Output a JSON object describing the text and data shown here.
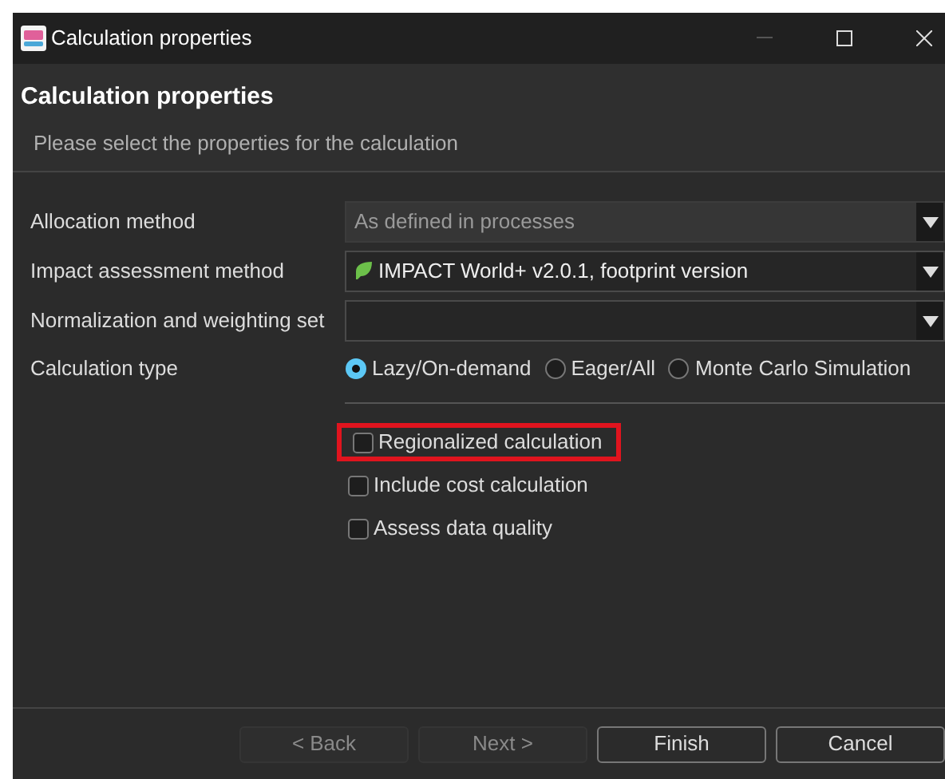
{
  "window": {
    "title": "Calculation properties"
  },
  "header": {
    "title": "Calculation properties",
    "description": "Please select the properties for the calculation"
  },
  "fields": [
    {
      "label": "Allocation method",
      "value": "As defined in processes",
      "disabled": true,
      "has_icon": false
    },
    {
      "label": "Impact assessment method",
      "value": "IMPACT World+ v2.0.1, footprint version",
      "disabled": false,
      "has_icon": true
    },
    {
      "label": "Normalization and weighting set",
      "disabled": false,
      "has_icon": false
    }
  ],
  "calculation_type": {
    "label": "Calculation type",
    "options": [
      {
        "label": "Lazy/On-demand",
        "selected": true
      },
      {
        "label": "Eager/All",
        "selected": false
      },
      {
        "label": "Monte Carlo Simulation",
        "selected": false
      }
    ]
  },
  "checkboxes": [
    {
      "label": "Regionalized calculation",
      "checked": false,
      "highlighted": true
    },
    {
      "label": "Include cost calculation",
      "checked": false,
      "highlighted": false
    },
    {
      "label": "Assess data quality",
      "checked": false,
      "highlighted": false
    }
  ],
  "buttons": [
    {
      "label": "< Back",
      "disabled": true
    },
    {
      "label": "Next >",
      "disabled": true
    },
    {
      "label": "Finish",
      "disabled": false
    },
    {
      "label": "Cancel",
      "disabled": false
    }
  ]
}
